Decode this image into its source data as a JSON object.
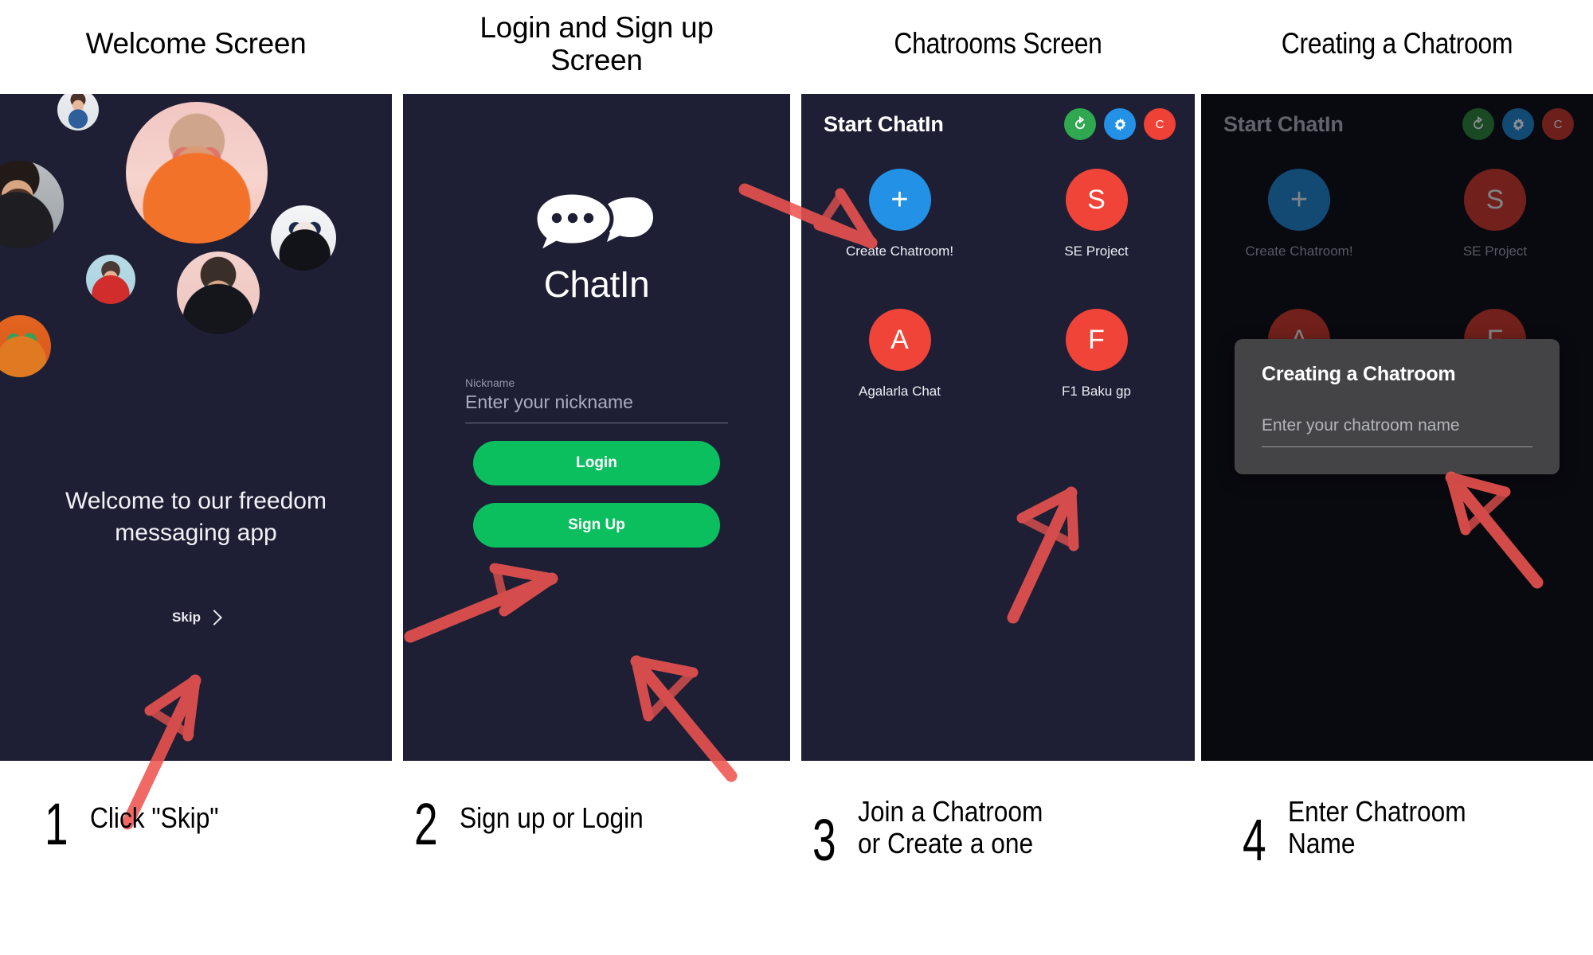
{
  "headings": [
    {
      "id": "welcome",
      "label": "Welcome Screen"
    },
    {
      "id": "login",
      "label": "Login and Sign up\nScreen"
    },
    {
      "id": "chatrooms",
      "label": "Chatrooms Screen"
    },
    {
      "id": "creating",
      "label": "Creating a Chatroom"
    }
  ],
  "welcome_screen": {
    "headline": "Welcome to our freedom messaging app",
    "skip_label": "Skip",
    "skip_icon": "chevron-right-icon",
    "avatars": [
      "avatar-woman-denim",
      "avatar-bearded-man",
      "avatar-man-orange-hoodie",
      "avatar-masked-face",
      "avatar-smiling-man-red-shirt",
      "avatar-colorful-makeup",
      "avatar-man-sunglasses"
    ]
  },
  "login_screen": {
    "logo_icon": "chat-bubbles-icon",
    "logo_text": "ChatIn",
    "nickname_label": "Nickname",
    "nickname_placeholder": "Enter your nickname",
    "nickname_value": "",
    "login_label": "Login",
    "signup_label": "Sign Up",
    "button_color": "#0bbf5f"
  },
  "chatrooms_screen": {
    "title": "Start ChatIn",
    "header_buttons": [
      {
        "id": "refresh",
        "icon": "refresh-icon",
        "glyph": "↻",
        "color": "#2fa84f"
      },
      {
        "id": "settings",
        "icon": "gear-icon",
        "glyph": "⚙",
        "color": "#2391e6"
      },
      {
        "id": "c-button",
        "icon": "c-letter-icon",
        "glyph": "C",
        "color": "#ef4136"
      }
    ],
    "rooms": [
      {
        "id": "create",
        "glyph": "+",
        "label": "Create Chatroom!",
        "color": "#2391e6",
        "is_create": true
      },
      {
        "id": "se-project",
        "glyph": "S",
        "label": "SE Project",
        "color": "#f04438",
        "is_create": false
      },
      {
        "id": "agalarla-chat",
        "glyph": "A",
        "label": "Agalarla Chat",
        "color": "#f04438",
        "is_create": false
      },
      {
        "id": "f1-baku-gp",
        "glyph": "F",
        "label": "F1 Baku gp",
        "color": "#f04438",
        "is_create": false
      }
    ]
  },
  "create_dialog": {
    "title": "Creating a Chatroom",
    "input_placeholder": "Enter your chatroom name",
    "input_value": "",
    "background": "#444447"
  },
  "steps": [
    {
      "number": "1",
      "text": "Click \"Skip\""
    },
    {
      "number": "2",
      "text": "Sign up or Login"
    },
    {
      "number": "3",
      "text": "Join a Chatroom\nor Create a one"
    },
    {
      "number": "4",
      "text": "Enter Chatroom\nName"
    }
  ],
  "annotations": {
    "arrow_color": "#ee5550",
    "arrows": [
      {
        "id": "arrow-to-skip",
        "target": "skip-button"
      },
      {
        "id": "arrow-to-login",
        "target": "login-button"
      },
      {
        "id": "arrow-to-signup",
        "target": "signup-button"
      },
      {
        "id": "arrow-to-create-chatroom",
        "target": "create-chatroom-button"
      },
      {
        "id": "arrow-to-f1-baku",
        "target": "room-f1-baku-gp"
      },
      {
        "id": "arrow-to-chatroom-name-input",
        "target": "chatroom-name-input"
      }
    ]
  }
}
